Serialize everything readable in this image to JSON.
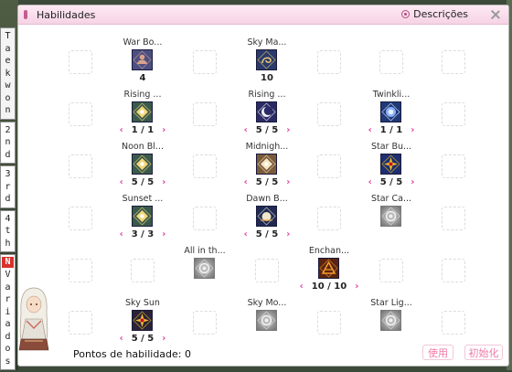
{
  "window": {
    "title": "Habilidades",
    "descriptions_label": "Descrições"
  },
  "side_tabs": [
    {
      "id": "taekwon",
      "chars": [
        "T",
        "a",
        "e",
        "k",
        "w",
        "o",
        "n"
      ]
    },
    {
      "id": "2nd",
      "chars": [
        "2",
        "n",
        "d"
      ]
    },
    {
      "id": "3rd",
      "chars": [
        "3",
        "r",
        "d"
      ]
    },
    {
      "id": "4th",
      "chars": [
        "4",
        "t",
        "h"
      ]
    },
    {
      "id": "variados",
      "badge": "N",
      "chars": [
        "V",
        "a",
        "r",
        "i",
        "a",
        "d",
        "o",
        "s"
      ]
    }
  ],
  "skills": [
    {
      "name": "War Bo...",
      "level": "4",
      "arrows": false,
      "icon": "war-body-icon",
      "style": "color",
      "theme": "war"
    },
    {
      "name": "Sky Ma...",
      "level": "10",
      "arrows": false,
      "icon": "sky-mastery-icon",
      "style": "color",
      "theme": "sky"
    },
    {
      "name": "Rising ...",
      "level": "1 / 1",
      "arrows": true,
      "icon": "rising-sun-icon",
      "style": "color",
      "theme": "sun"
    },
    {
      "name": "Rising ...",
      "level": "5 / 5",
      "arrows": true,
      "icon": "rising-moon-icon",
      "style": "color",
      "theme": "moon"
    },
    {
      "name": "Twinkli...",
      "level": "1 / 1",
      "arrows": true,
      "icon": "twinkling-galaxy-icon",
      "style": "color",
      "theme": "twinkle"
    },
    {
      "name": "Noon Bl...",
      "level": "5 / 5",
      "arrows": true,
      "icon": "noon-blast-icon",
      "style": "color",
      "theme": "sun"
    },
    {
      "name": "Midnigh...",
      "level": "5 / 5",
      "arrows": true,
      "icon": "midnight-fall-icon",
      "style": "color",
      "theme": "star"
    },
    {
      "name": "Star Bu...",
      "level": "5 / 5",
      "arrows": true,
      "icon": "star-burst-icon",
      "style": "color",
      "theme": "starburst"
    },
    {
      "name": "Sunset ...",
      "level": "3 / 3",
      "arrows": true,
      "icon": "sunset-blast-icon",
      "style": "color",
      "theme": "sun"
    },
    {
      "name": "Dawn B...",
      "level": "5 / 5",
      "arrows": true,
      "icon": "dawn-break-icon",
      "style": "color",
      "theme": "dawn"
    },
    {
      "name": "Star Ca...",
      "level": "",
      "arrows": false,
      "icon": "star-cannon-icon",
      "style": "gray",
      "theme": "gray"
    },
    {
      "name": "All in th...",
      "level": "",
      "arrows": false,
      "icon": "all-in-the-sky-icon",
      "style": "gray",
      "theme": "gray"
    },
    {
      "name": "Enchan...",
      "level": "10 / 10",
      "arrows": true,
      "icon": "enchanting-sky-icon",
      "style": "color",
      "theme": "enchant"
    },
    {
      "name": "Sky Sun",
      "level": "5 / 5",
      "arrows": true,
      "icon": "sky-sun-icon",
      "style": "color",
      "theme": "skysun"
    },
    {
      "name": "Sky Mo...",
      "level": "",
      "arrows": false,
      "icon": "sky-moon-icon",
      "style": "gray",
      "theme": "gray"
    },
    {
      "name": "Star Lig...",
      "level": "",
      "arrows": false,
      "icon": "star-light-icon",
      "style": "gray",
      "theme": "gray"
    }
  ],
  "footer": {
    "points_label": "Pontos de habilidade: 0",
    "use_button": "使用",
    "reset_button": "初始化"
  },
  "colors": {
    "accent_pink": "#e040a0",
    "title_bar": "#f6d3e5",
    "button_text": "#f07aa8"
  }
}
